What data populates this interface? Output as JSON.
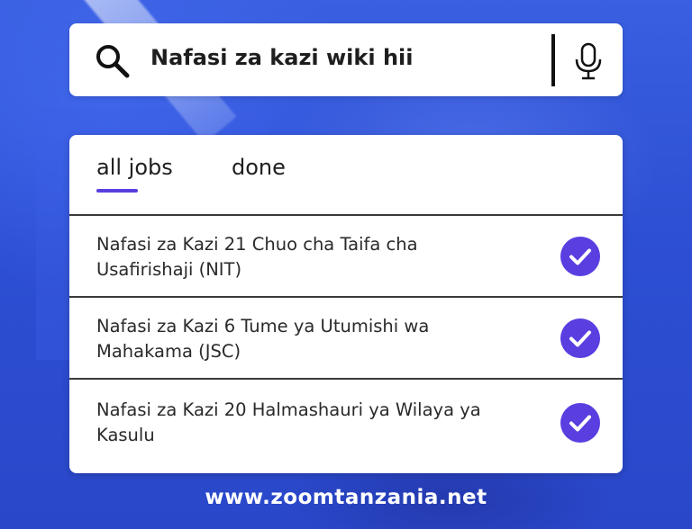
{
  "search": {
    "query": "Nafasi za kazi wiki hii",
    "icon": "search-icon",
    "voice_icon": "microphone-icon"
  },
  "tabs": [
    {
      "label": "all jobs",
      "active": true
    },
    {
      "label": "done",
      "active": false
    }
  ],
  "jobs": [
    {
      "title": "Nafasi za Kazi 21 Chuo cha Taifa cha Usafirishaji (NIT)",
      "checked": true
    },
    {
      "title": "Nafasi za Kazi 6 Tume ya Utumishi wa Mahakama (JSC)",
      "checked": true
    },
    {
      "title": "Nafasi za Kazi 20 Halmashauri ya Wilaya ya Kasulu",
      "checked": true
    }
  ],
  "footer": {
    "url": "www.zoomtanzania.net"
  },
  "colors": {
    "background": "#2f4fd0",
    "accent": "#5a3ee0",
    "card": "#ffffff"
  }
}
